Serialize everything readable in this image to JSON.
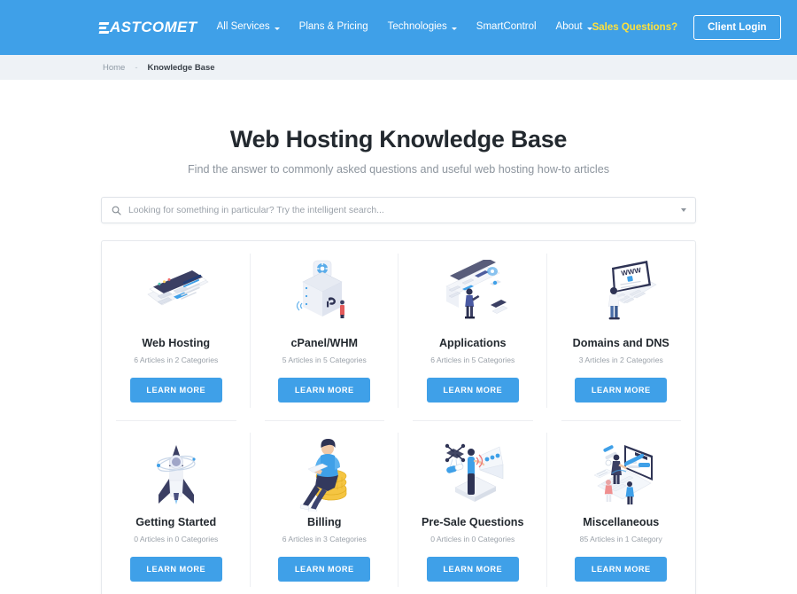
{
  "header": {
    "logo_text": "ASTCOMET",
    "logo_icon": "fastcomet-speed-mark-icon",
    "nav": [
      {
        "label": "All Services",
        "has_caret": true
      },
      {
        "label": "Plans & Pricing",
        "has_caret": false
      },
      {
        "label": "Technologies",
        "has_caret": true
      },
      {
        "label": "SmartControl",
        "has_caret": false
      },
      {
        "label": "About",
        "has_caret": true
      }
    ],
    "sales_link": "Sales Questions?",
    "login_button": "Client Login",
    "background_color": "#3fa0e8",
    "sales_color": "#ffe13b"
  },
  "breadcrumb": {
    "home": "Home",
    "separator": "-",
    "current": "Knowledge Base"
  },
  "hero": {
    "title": "Web Hosting Knowledge Base",
    "subtitle": "Find the answer to commonly asked questions and useful web hosting how-to articles"
  },
  "search": {
    "placeholder": "Looking for something in particular? Try the intelligent search...",
    "value": "",
    "icon": "search-icon",
    "dropdown_icon": "chevron-down-icon"
  },
  "categories": [
    {
      "title": "Web Hosting",
      "meta": "6 Articles in 2 Categories",
      "button": "LEARN MORE",
      "illustration": "isometric-browser-window-icon"
    },
    {
      "title": "cPanel/WHM",
      "meta": "5 Articles in 5 Categories",
      "button": "LEARN MORE",
      "illustration": "isometric-server-stack-icon"
    },
    {
      "title": "Applications",
      "meta": "6 Articles in 5 Categories",
      "button": "LEARN MORE",
      "illustration": "isometric-app-dashboard-person-icon"
    },
    {
      "title": "Domains and DNS",
      "meta": "3 Articles in 2 Categories",
      "button": "LEARN MORE",
      "illustration": "isometric-laptop-www-icon"
    },
    {
      "title": "Getting Started",
      "meta": "0 Articles in 0 Categories",
      "button": "LEARN MORE",
      "illustration": "rocket-orbit-icon"
    },
    {
      "title": "Billing",
      "meta": "6 Articles in 3 Categories",
      "button": "LEARN MORE",
      "illustration": "person-on-coins-icon"
    },
    {
      "title": "Pre-Sale Questions",
      "meta": "0 Articles in 0 Categories",
      "button": "LEARN MORE",
      "illustration": "person-presentation-screen-icon"
    },
    {
      "title": "Miscellaneous",
      "meta": "85 Articles in 1 Category",
      "button": "LEARN MORE",
      "illustration": "isometric-laptop-workspace-icon"
    }
  ],
  "theme": {
    "accent": "#3fa0e8",
    "breadcrumb_bg": "#eef2f6",
    "text_dark": "#23292f",
    "text_muted": "#9aa1a9"
  }
}
